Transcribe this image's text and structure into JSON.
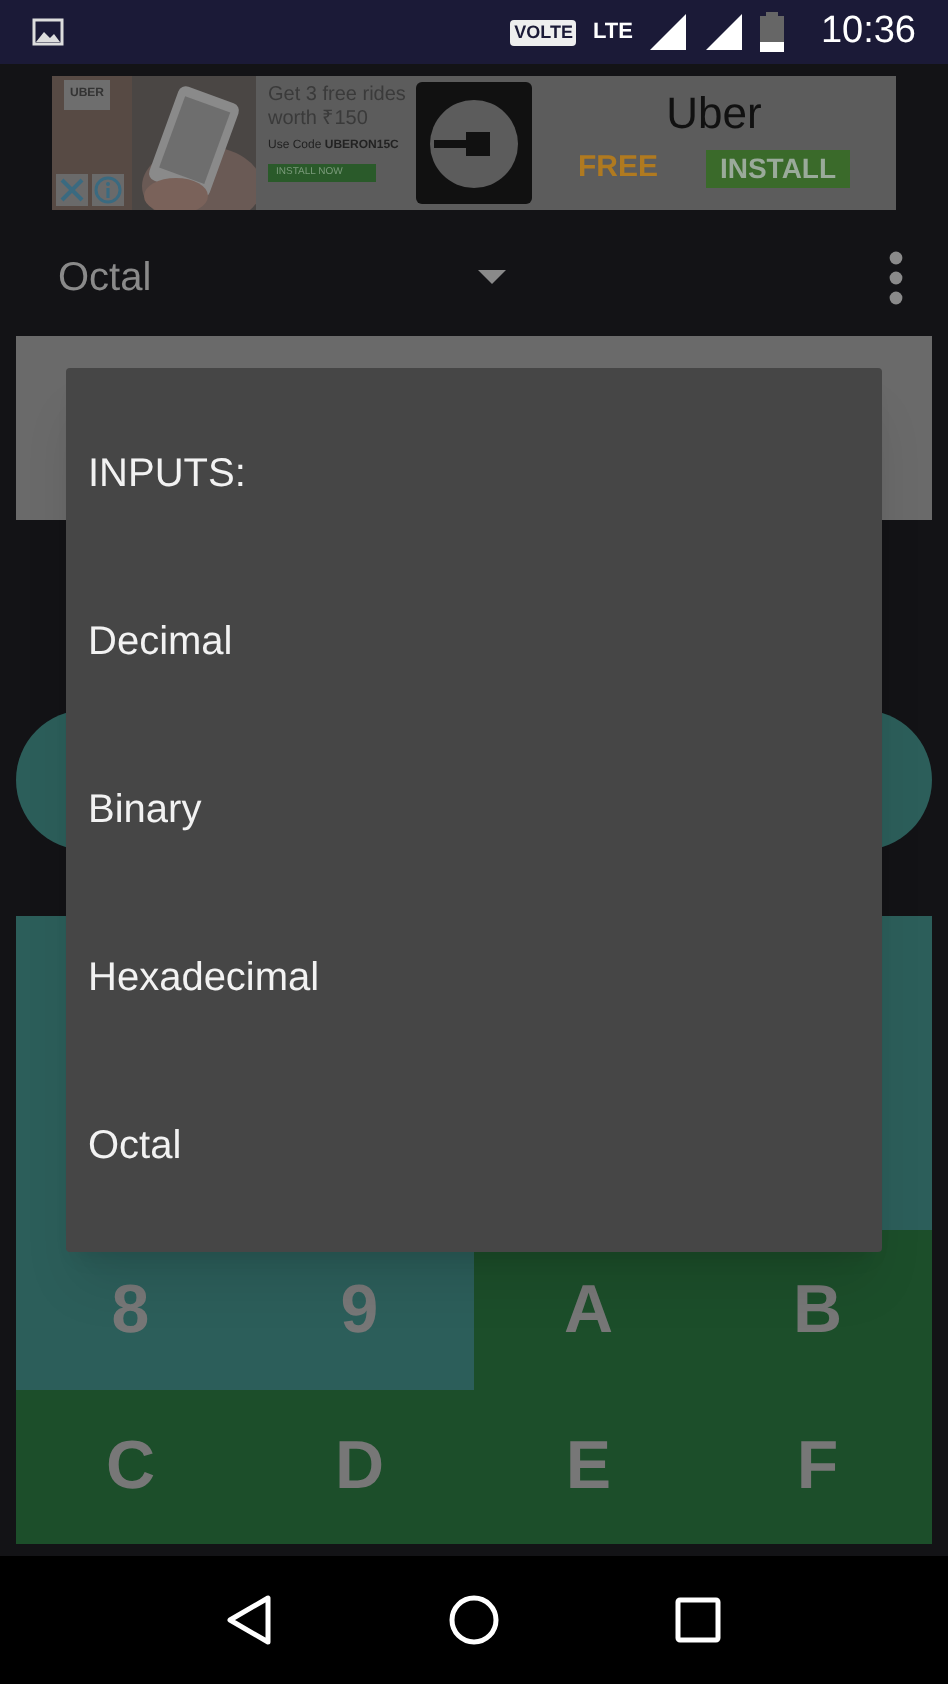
{
  "status_bar": {
    "volte": "VOLTE",
    "network": "LTE",
    "time": "10:36"
  },
  "ad": {
    "brand_tag": "UBER",
    "headline": "Get 3 free rides worth ₹150",
    "code_prefix": "Use Code",
    "code": "UBERON15C",
    "small_button": "INSTALL NOW",
    "title": "Uber",
    "price": "FREE",
    "install": "INSTALL"
  },
  "toolbar": {
    "spinner_value": "Octal"
  },
  "dialog": {
    "title": "INPUTS:",
    "options": [
      {
        "label": "Decimal"
      },
      {
        "label": "Binary"
      },
      {
        "label": "Hexadecimal"
      },
      {
        "label": "Octal"
      }
    ]
  },
  "keypad": {
    "keys": [
      {
        "label": "8",
        "kind": "digit"
      },
      {
        "label": "9",
        "kind": "digit"
      },
      {
        "label": "A",
        "kind": "hex"
      },
      {
        "label": "B",
        "kind": "hex"
      },
      {
        "label": "C",
        "kind": "hex"
      },
      {
        "label": "D",
        "kind": "hex"
      },
      {
        "label": "E",
        "kind": "hex"
      },
      {
        "label": "F",
        "kind": "hex"
      }
    ]
  }
}
